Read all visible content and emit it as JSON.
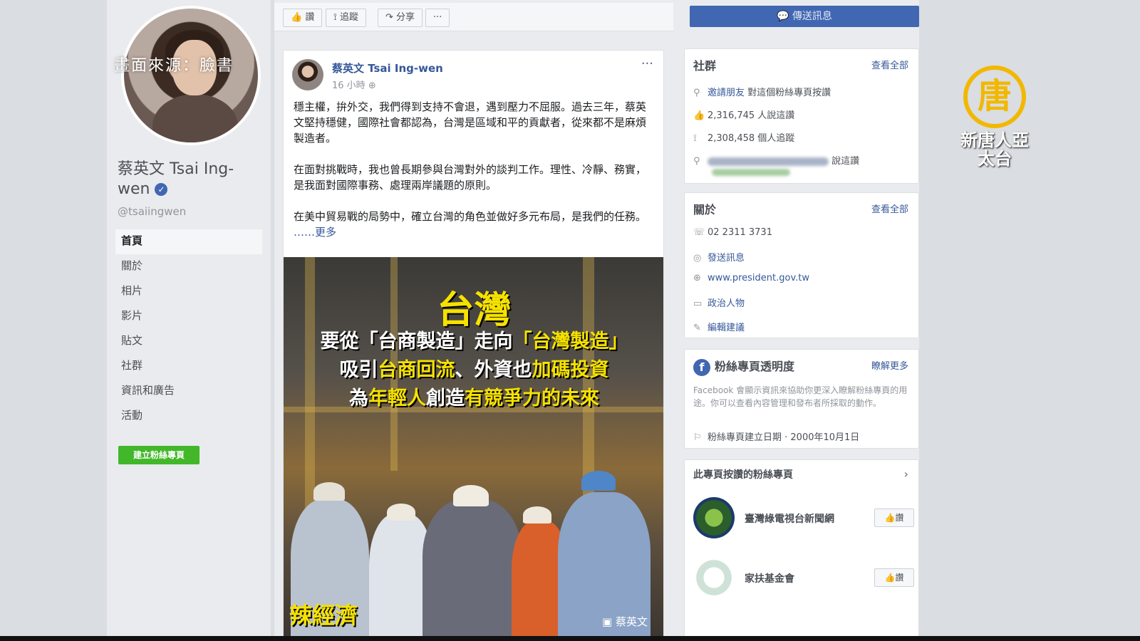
{
  "watermark": {
    "credit": "畫面來源：臉書",
    "channel_glyph": "唐",
    "channel_name": "新唐人亞太台",
    "brand_color": "#f2b800"
  },
  "profile": {
    "name": "蔡英文 Tsai Ing-wen",
    "verified_mark": "✓",
    "handle": "@tsaiingwen",
    "nav": [
      "首頁",
      "關於",
      "相片",
      "影片",
      "貼文",
      "社群",
      "資訊和廣告",
      "活動"
    ],
    "create_page": "建立粉絲專頁"
  },
  "actions": {
    "like": "讚",
    "follow": "追蹤",
    "share": "分享",
    "more": "···"
  },
  "message_button": "傳送訊息",
  "post": {
    "author": "蔡英文 Tsai Ing-wen",
    "time": "16 小時",
    "menu": "···",
    "paragraphs": [
      "穩主權，拚外交，我們得到支持不會退，遇到壓力不屈服。過去三年，蔡英文堅持穩健，國際社會都認為，台灣是區域和平的貢獻者，從來都不是麻煩製造者。",
      "在面對挑戰時，我也曾長期參與台灣對外的談判工作。理性、冷靜、務實，是我面對國際事務、處理兩岸議題的原則。"
    ],
    "last_paragraph": "在美中貿易戰的局勢中，確立台灣的角色並做好多元布局，是我們的任務。",
    "more_link": "……更多",
    "image": {
      "title": "台灣",
      "line1_a": "要從「台商製造」走向",
      "line1_b": "「台灣製造」",
      "line2_a": "吸引",
      "line2_b": "台商回流",
      "line2_c": "、外資也",
      "line2_d": "加碼投資",
      "line3_a": "為",
      "line3_b": "年輕人",
      "line3_c": "創造",
      "line3_d": "有競爭力的未來",
      "tag": "辣經濟",
      "sign": "蔡英文"
    }
  },
  "community": {
    "title": "社群",
    "see_all": "查看全部",
    "invite": "邀請朋友",
    "invite_suffix": "對這個粉絲專頁按讚",
    "likes": "2,316,745 人說這讚",
    "follows": "2,308,458 個人追蹤",
    "friends_suffix": "說這讚"
  },
  "about": {
    "title": "關於",
    "see_all": "查看全部",
    "phone": "02 2311 3731",
    "message": "發送訊息",
    "website": "www.president.gov.tw",
    "category": "政治人物",
    "edit": "編輯建議"
  },
  "transparency": {
    "title": "粉絲專頁透明度",
    "link": "瞭解更多",
    "desc": "Facebook 會顯示資訊來協助你更深入瞭解粉絲專頁的用途。你可以查看內容管理和發布者所採取的動作。",
    "created": "粉絲專頁建立日期 · 2000年10月1日"
  },
  "liked_pages": {
    "title": "此專頁按讚的粉絲專頁",
    "items": [
      {
        "name": "臺灣綠電視台新聞網",
        "button": "讚",
        "color": "#2b5e2a"
      },
      {
        "name": "家扶基金會",
        "button": "讚",
        "color": "#cfe2d8"
      }
    ]
  }
}
